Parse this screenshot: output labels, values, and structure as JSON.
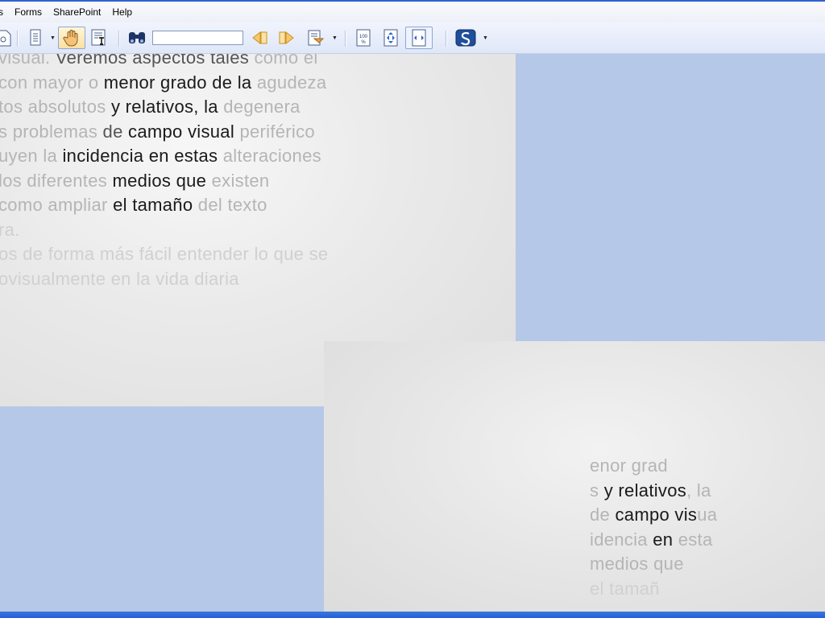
{
  "menu": {
    "items": [
      "s",
      "Forms",
      "SharePoint",
      "Help"
    ]
  },
  "toolbar": {
    "search_value": ""
  },
  "doc_main": {
    "lines": [
      [
        [
          "f",
          "visual. "
        ],
        [
          "m",
          "Veremos aspectos tales "
        ],
        [
          "f",
          "como el"
        ]
      ],
      [
        [
          "f",
          "con mayor o "
        ],
        [
          "b",
          "menor grado de la "
        ],
        [
          "f",
          "agudeza"
        ]
      ],
      [
        [
          "f",
          "tos absolutos "
        ],
        [
          "b",
          "y relativos, la "
        ],
        [
          "f",
          "degenera"
        ]
      ],
      [
        [
          "f",
          "s problemas "
        ],
        [
          "m",
          "de "
        ],
        [
          "b",
          "campo visual "
        ],
        [
          "f",
          "periférico"
        ]
      ],
      [
        [
          "f",
          "uyen la "
        ],
        [
          "b",
          "incidencia en estas "
        ],
        [
          "f",
          "alteraciones"
        ]
      ],
      [
        [
          "f",
          "los diferentes "
        ],
        [
          "b",
          "medios que "
        ],
        [
          "f",
          "existen"
        ]
      ],
      [
        [
          "f",
          "como ampliar "
        ],
        [
          "b",
          "el tamaño "
        ],
        [
          "f",
          "del texto"
        ]
      ],
      [
        [
          "ff",
          "ra."
        ]
      ],
      [
        [
          "ff",
          "os de forma más fácil entender lo que se"
        ]
      ],
      [
        [
          "ff",
          "ovisualmente en la vida diaria"
        ]
      ]
    ]
  },
  "doc_zoom": {
    "lines": [
      [
        [
          "f",
          "enor grad"
        ]
      ],
      [
        [
          "f",
          "s "
        ],
        [
          "b",
          "y relativos"
        ],
        [
          "f",
          ", la"
        ]
      ],
      [
        [
          "f",
          "de "
        ],
        [
          "b",
          "campo vis"
        ],
        [
          "f",
          "ua"
        ]
      ],
      [
        [
          "f",
          "idencia "
        ],
        [
          "b",
          "en "
        ],
        [
          "f",
          "esta"
        ]
      ],
      [
        [
          "f",
          "medios que"
        ]
      ],
      [
        [
          "ff",
          "el tamañ"
        ]
      ]
    ]
  },
  "colors": {
    "accent": "#2f62cf",
    "desktop": "#b6c8e8",
    "page": "#e6e6e6"
  }
}
